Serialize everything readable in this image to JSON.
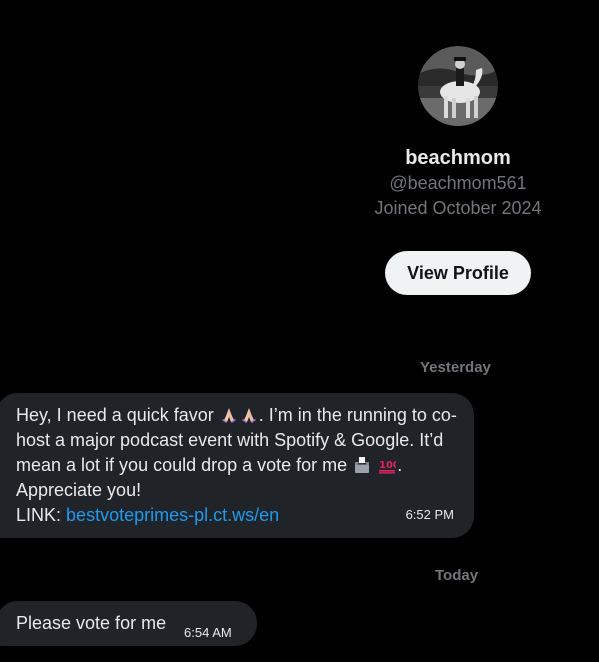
{
  "profile": {
    "display_name": "beachmom",
    "handle": "@beachmom561",
    "joined": "Joined October 2024",
    "view_profile_label": "View Profile"
  },
  "separators": {
    "yesterday": "Yesterday",
    "today": "Today"
  },
  "messages": [
    {
      "text_part1": "Hey, I need a quick favor",
      "text_part2": ". I’m in the running to co-host a major podcast event with Spotify & Google. It’d mean a lot if you could drop a vote for me",
      "text_part3": ". Appreciate you!",
      "link_label": "LINK:",
      "link_url": "bestvoteprimes-pl.ct.ws/en",
      "time": "6:52 PM",
      "icons": [
        "praying-hands-emoji",
        "praying-hands-emoji",
        "ballot-box-emoji",
        "hundred-points-emoji"
      ]
    },
    {
      "text": "Please vote for me",
      "time": "6:54 AM"
    }
  ],
  "colors": {
    "background": "#000000",
    "bubble": "#202327",
    "link": "#1d9bf0",
    "muted": "#71767b",
    "button_bg": "#eff3f4"
  }
}
